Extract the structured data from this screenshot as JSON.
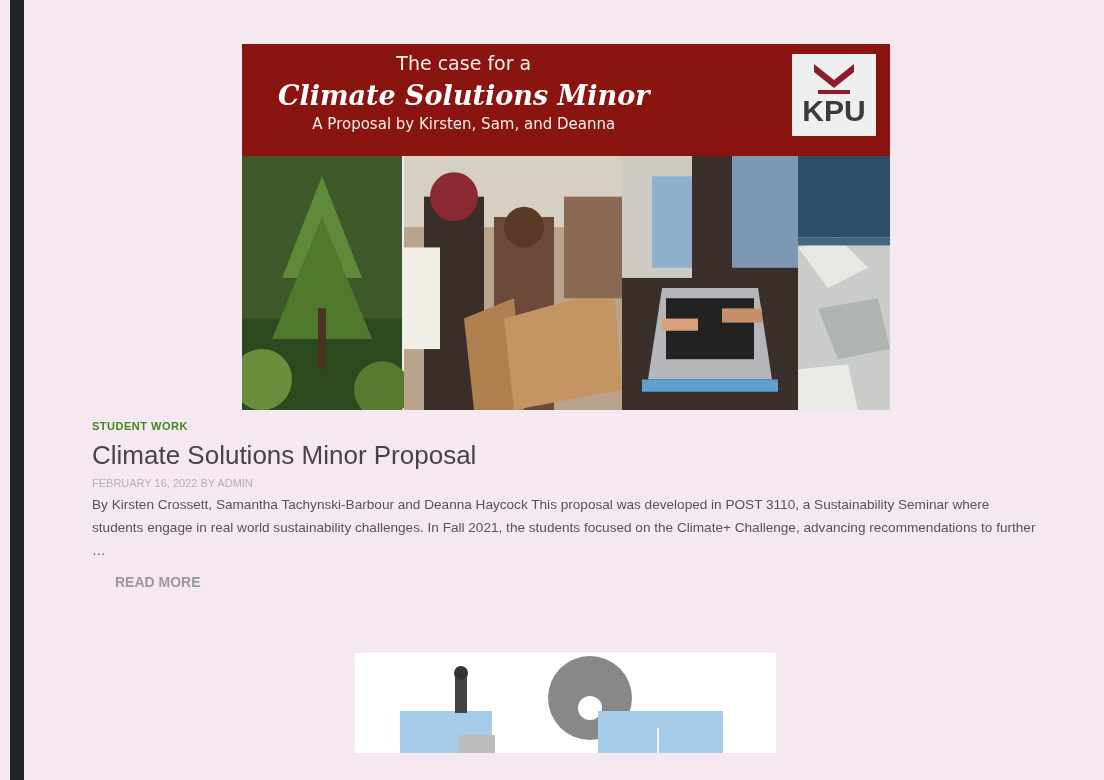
{
  "featured_image": {
    "kicker": "The case for a",
    "title": "Climate Solutions Minor",
    "byline": "A Proposal by Kirsten, Sam, and Deanna",
    "logo": "KPU"
  },
  "post": {
    "category": "STUDENT WORK",
    "title": "Climate Solutions Minor Proposal",
    "meta": "FEBRUARY 16, 2022 BY ADMIN",
    "excerpt": "By Kirsten Crossett, Samantha Tachynski-Barbour and Deanna Haycock This proposal was developed in POST 3110, a Sustainability Seminar where students engage in real world sustainability challenges. In Fall 2021, the students focused on the Climate+ Challenge, advancing recommendations  to further …",
    "read_more": "READ MORE"
  }
}
